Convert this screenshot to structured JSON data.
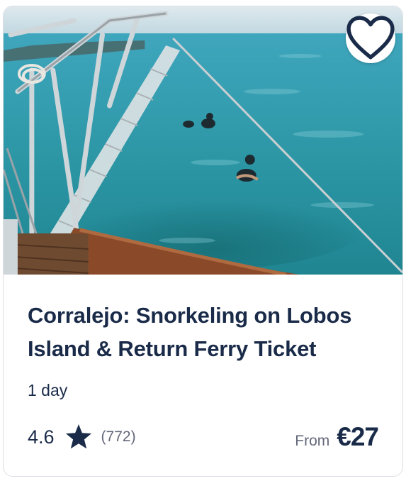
{
  "card": {
    "image_alt_icon": "snorkeling-boat-photo",
    "wishlist_icon": "heart-icon",
    "title": "Corralejo: Snorkeling on Lobos Island & Return Ferry Ticket",
    "duration": "1 day",
    "rating": "4.6",
    "rating_icon": "star-icon",
    "review_count": "(772)",
    "price_label": "From",
    "price": "€27"
  },
  "colors": {
    "text_primary": "#1a2b49",
    "text_secondary": "#63687a",
    "sea": "#2f9fb0",
    "card_border": "#dcdfe4"
  }
}
